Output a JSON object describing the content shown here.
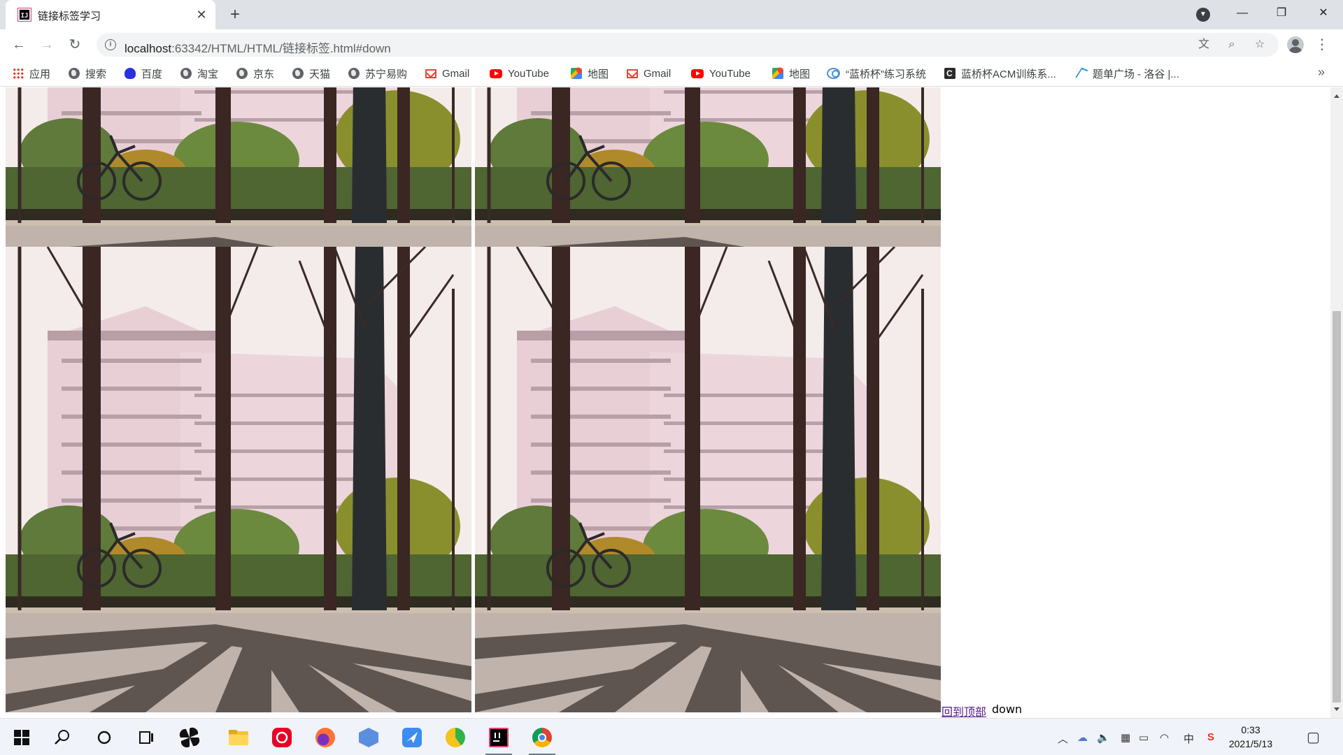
{
  "browser": {
    "tab_title": "链接标签学习",
    "url_host": "localhost",
    "url_path": ":63342/HTML/HTML/链接标签.html#down"
  },
  "bookmarks": [
    {
      "label": "应用",
      "icon": "apps-icon"
    },
    {
      "label": "搜索",
      "icon": "globe-icon"
    },
    {
      "label": "百度",
      "icon": "baidu-icon"
    },
    {
      "label": "淘宝",
      "icon": "globe-icon"
    },
    {
      "label": "京东",
      "icon": "globe-icon"
    },
    {
      "label": "天猫",
      "icon": "globe-icon"
    },
    {
      "label": "苏宁易购",
      "icon": "globe-icon"
    },
    {
      "label": "Gmail",
      "icon": "gmail-icon"
    },
    {
      "label": "YouTube",
      "icon": "youtube-icon"
    },
    {
      "label": "地图",
      "icon": "maps-icon"
    },
    {
      "label": "Gmail",
      "icon": "gmail-icon"
    },
    {
      "label": "YouTube",
      "icon": "youtube-icon"
    },
    {
      "label": "地图",
      "icon": "maps-icon"
    },
    {
      "label": "“蓝桥杯”练习系统",
      "icon": "lanqiao-icon"
    },
    {
      "label": "蓝桥杯ACM训练系...",
      "icon": "c-icon"
    },
    {
      "label": "题单广场 - 洛谷 |...",
      "icon": "luogu-icon"
    }
  ],
  "page": {
    "back_to_top_link": "回到顶部",
    "anchor_text": "down",
    "photo_count": 4
  },
  "taskbar": {
    "time": "0:33",
    "date": "2021/5/13",
    "ime": "中"
  },
  "colors": {
    "tabstrip": "#dee1e6",
    "omnibox": "#f1f3f4",
    "visited_link": "#551a8b",
    "taskbar": "#f0f3f9"
  }
}
